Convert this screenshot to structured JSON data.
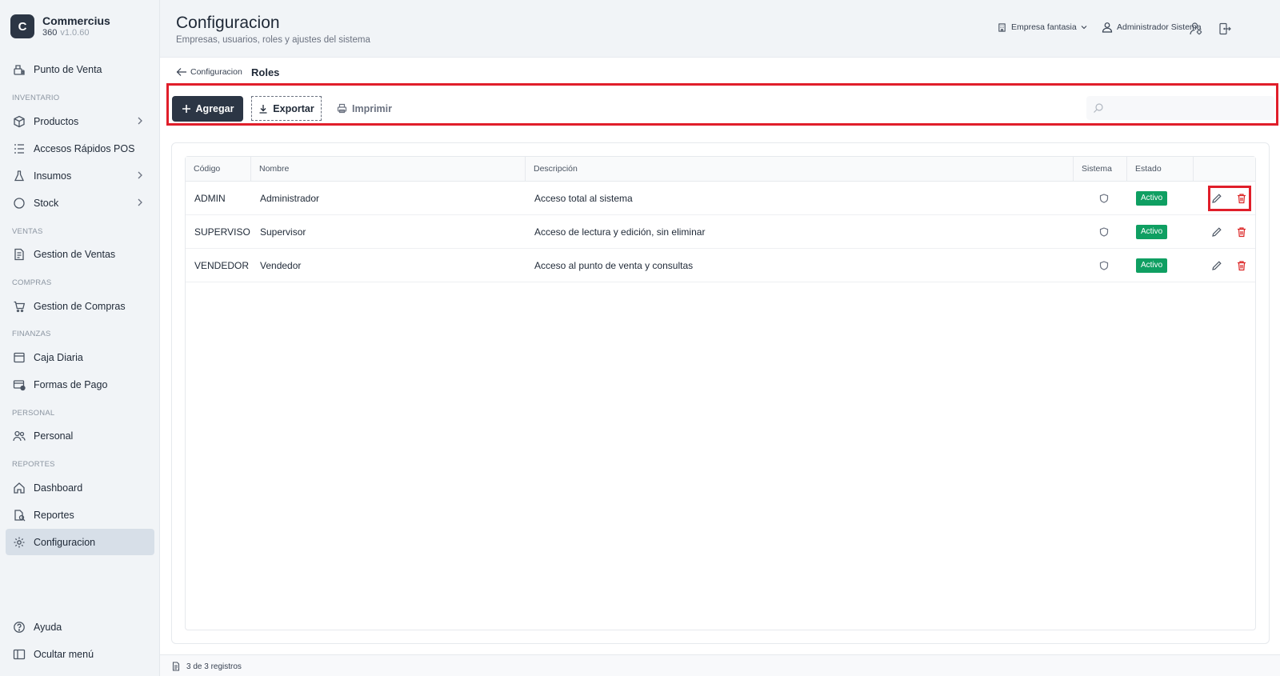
{
  "app": {
    "logo_letter": "C",
    "name": "Commercius",
    "edition": "360",
    "version": "v1.0.60"
  },
  "sidebar": {
    "punto_venta": "Punto de Venta",
    "sections": {
      "inventario": "INVENTARIO",
      "ventas": "VENTAS",
      "compras": "COMPRAS",
      "finanzas": "FINANZAS",
      "personal": "PERSONAL",
      "reportes": "REPORTES"
    },
    "items": {
      "productos": "Productos",
      "accesos": "Accesos Rápidos POS",
      "insumos": "Insumos",
      "stock": "Stock",
      "gestion_ventas": "Gestion de Ventas",
      "gestion_compras": "Gestion de Compras",
      "caja": "Caja Diaria",
      "formas_pago": "Formas de Pago",
      "personal": "Personal",
      "dashboard": "Dashboard",
      "reportes": "Reportes",
      "configuracion": "Configuracion"
    },
    "ayuda": "Ayuda",
    "ocultar": "Ocultar menú"
  },
  "header": {
    "title": "Configuracion",
    "subtitle": "Empresas, usuarios, roles y ajustes del sistema",
    "company": "Empresa fantasia",
    "user": "Administrador Sistema"
  },
  "breadcrumb": {
    "back": "Configuracion",
    "current": "Roles"
  },
  "toolbar": {
    "add": "Agregar",
    "export": "Exportar",
    "print": "Imprimir",
    "search_placeholder": ""
  },
  "table": {
    "columns": {
      "codigo": "Código",
      "nombre": "Nombre",
      "descripcion": "Descripción",
      "sistema": "Sistema",
      "estado": "Estado"
    },
    "rows": [
      {
        "codigo": "ADMIN",
        "nombre": "Administrador",
        "descripcion": "Acceso total al sistema",
        "estado": "Activo"
      },
      {
        "codigo": "SUPERVISO",
        "nombre": "Supervisor",
        "descripcion": "Acceso de lectura y edición, sin eliminar",
        "estado": "Activo"
      },
      {
        "codigo": "VENDEDOR",
        "nombre": "Vendedor",
        "descripcion": "Acceso al punto de venta y consultas",
        "estado": "Activo"
      }
    ]
  },
  "footer": {
    "records": "3 de 3 registros"
  },
  "colors": {
    "primary": "#2c3645",
    "active_badge": "#0f9f62",
    "delete": "#dc2626",
    "highlight": "#e01e2a"
  }
}
